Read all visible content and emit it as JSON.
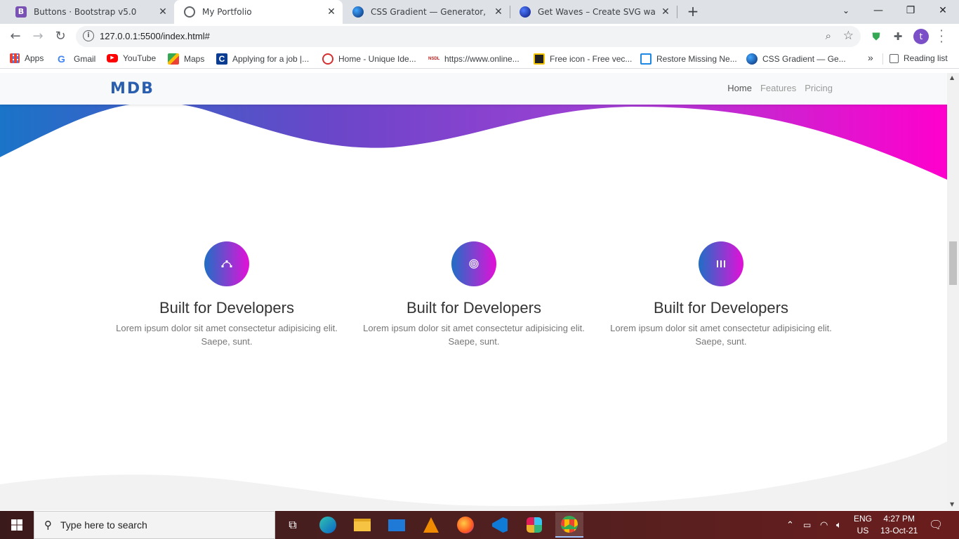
{
  "browser": {
    "tabs": [
      {
        "title": "Buttons · Bootstrap v5.0",
        "icon": "bootstrap-icon",
        "color": "#7952b3"
      },
      {
        "title": "My Portfolio",
        "icon": "globe-icon",
        "color": "#5f6368"
      },
      {
        "title": "CSS Gradient — Generator, Make",
        "icon": "cssgradient-icon",
        "color": "#1e3c72"
      },
      {
        "title": "Get Waves – Create SVG waves fo",
        "icon": "getwaves-icon",
        "color": "#1034a6"
      }
    ],
    "active_tab": 1,
    "url": "127.0.0.1:5500/index.html#",
    "profile_initial": "t",
    "bookmarks": [
      {
        "label": "Apps",
        "icon": "apps-grid-icon"
      },
      {
        "label": "Gmail",
        "icon": "google-icon"
      },
      {
        "label": "YouTube",
        "icon": "youtube-icon"
      },
      {
        "label": "Maps",
        "icon": "maps-icon"
      },
      {
        "label": "Applying for a job |...",
        "icon": "c-icon"
      },
      {
        "label": "Home - Unique Ide...",
        "icon": "fingerprint-icon"
      },
      {
        "label": "https://www.online...",
        "icon": "nsdl-icon"
      },
      {
        "label": "Free icon - Free vec...",
        "icon": "flaticon-icon"
      },
      {
        "label": "Restore Missing Ne...",
        "icon": "monitor-icon"
      },
      {
        "label": "CSS Gradient — Ge...",
        "icon": "cssgradient-icon"
      }
    ],
    "overflow_label": "»",
    "reading_list": "Reading list"
  },
  "site": {
    "brand": "MDB",
    "nav": [
      "Home",
      "Features",
      "Pricing"
    ],
    "features": [
      {
        "title": "Built for Developers",
        "text": "Lorem ipsum dolor sit amet consectetur adipisicing elit. Saepe, sunt.",
        "icon": "bezier-curve-icon"
      },
      {
        "title": "Built for Developers",
        "text": "Lorem ipsum dolor sit amet consectetur adipisicing elit. Saepe, sunt.",
        "icon": "fingerprint-icon"
      },
      {
        "title": "Built for Developers",
        "text": "Lorem ipsum dolor sit amet consectetur adipisicing elit. Saepe, sunt.",
        "icon": "pause-columns-icon"
      }
    ],
    "colors": {
      "gradient_start": "#1f6fc5",
      "gradient_mid": "#8a3cd0",
      "gradient_end": "#ff00cc"
    }
  },
  "taskbar": {
    "search_placeholder": "Type here to search",
    "lang_top": "ENG",
    "lang_bottom": "US",
    "time": "4:27 PM",
    "date": "13-Oct-21"
  }
}
